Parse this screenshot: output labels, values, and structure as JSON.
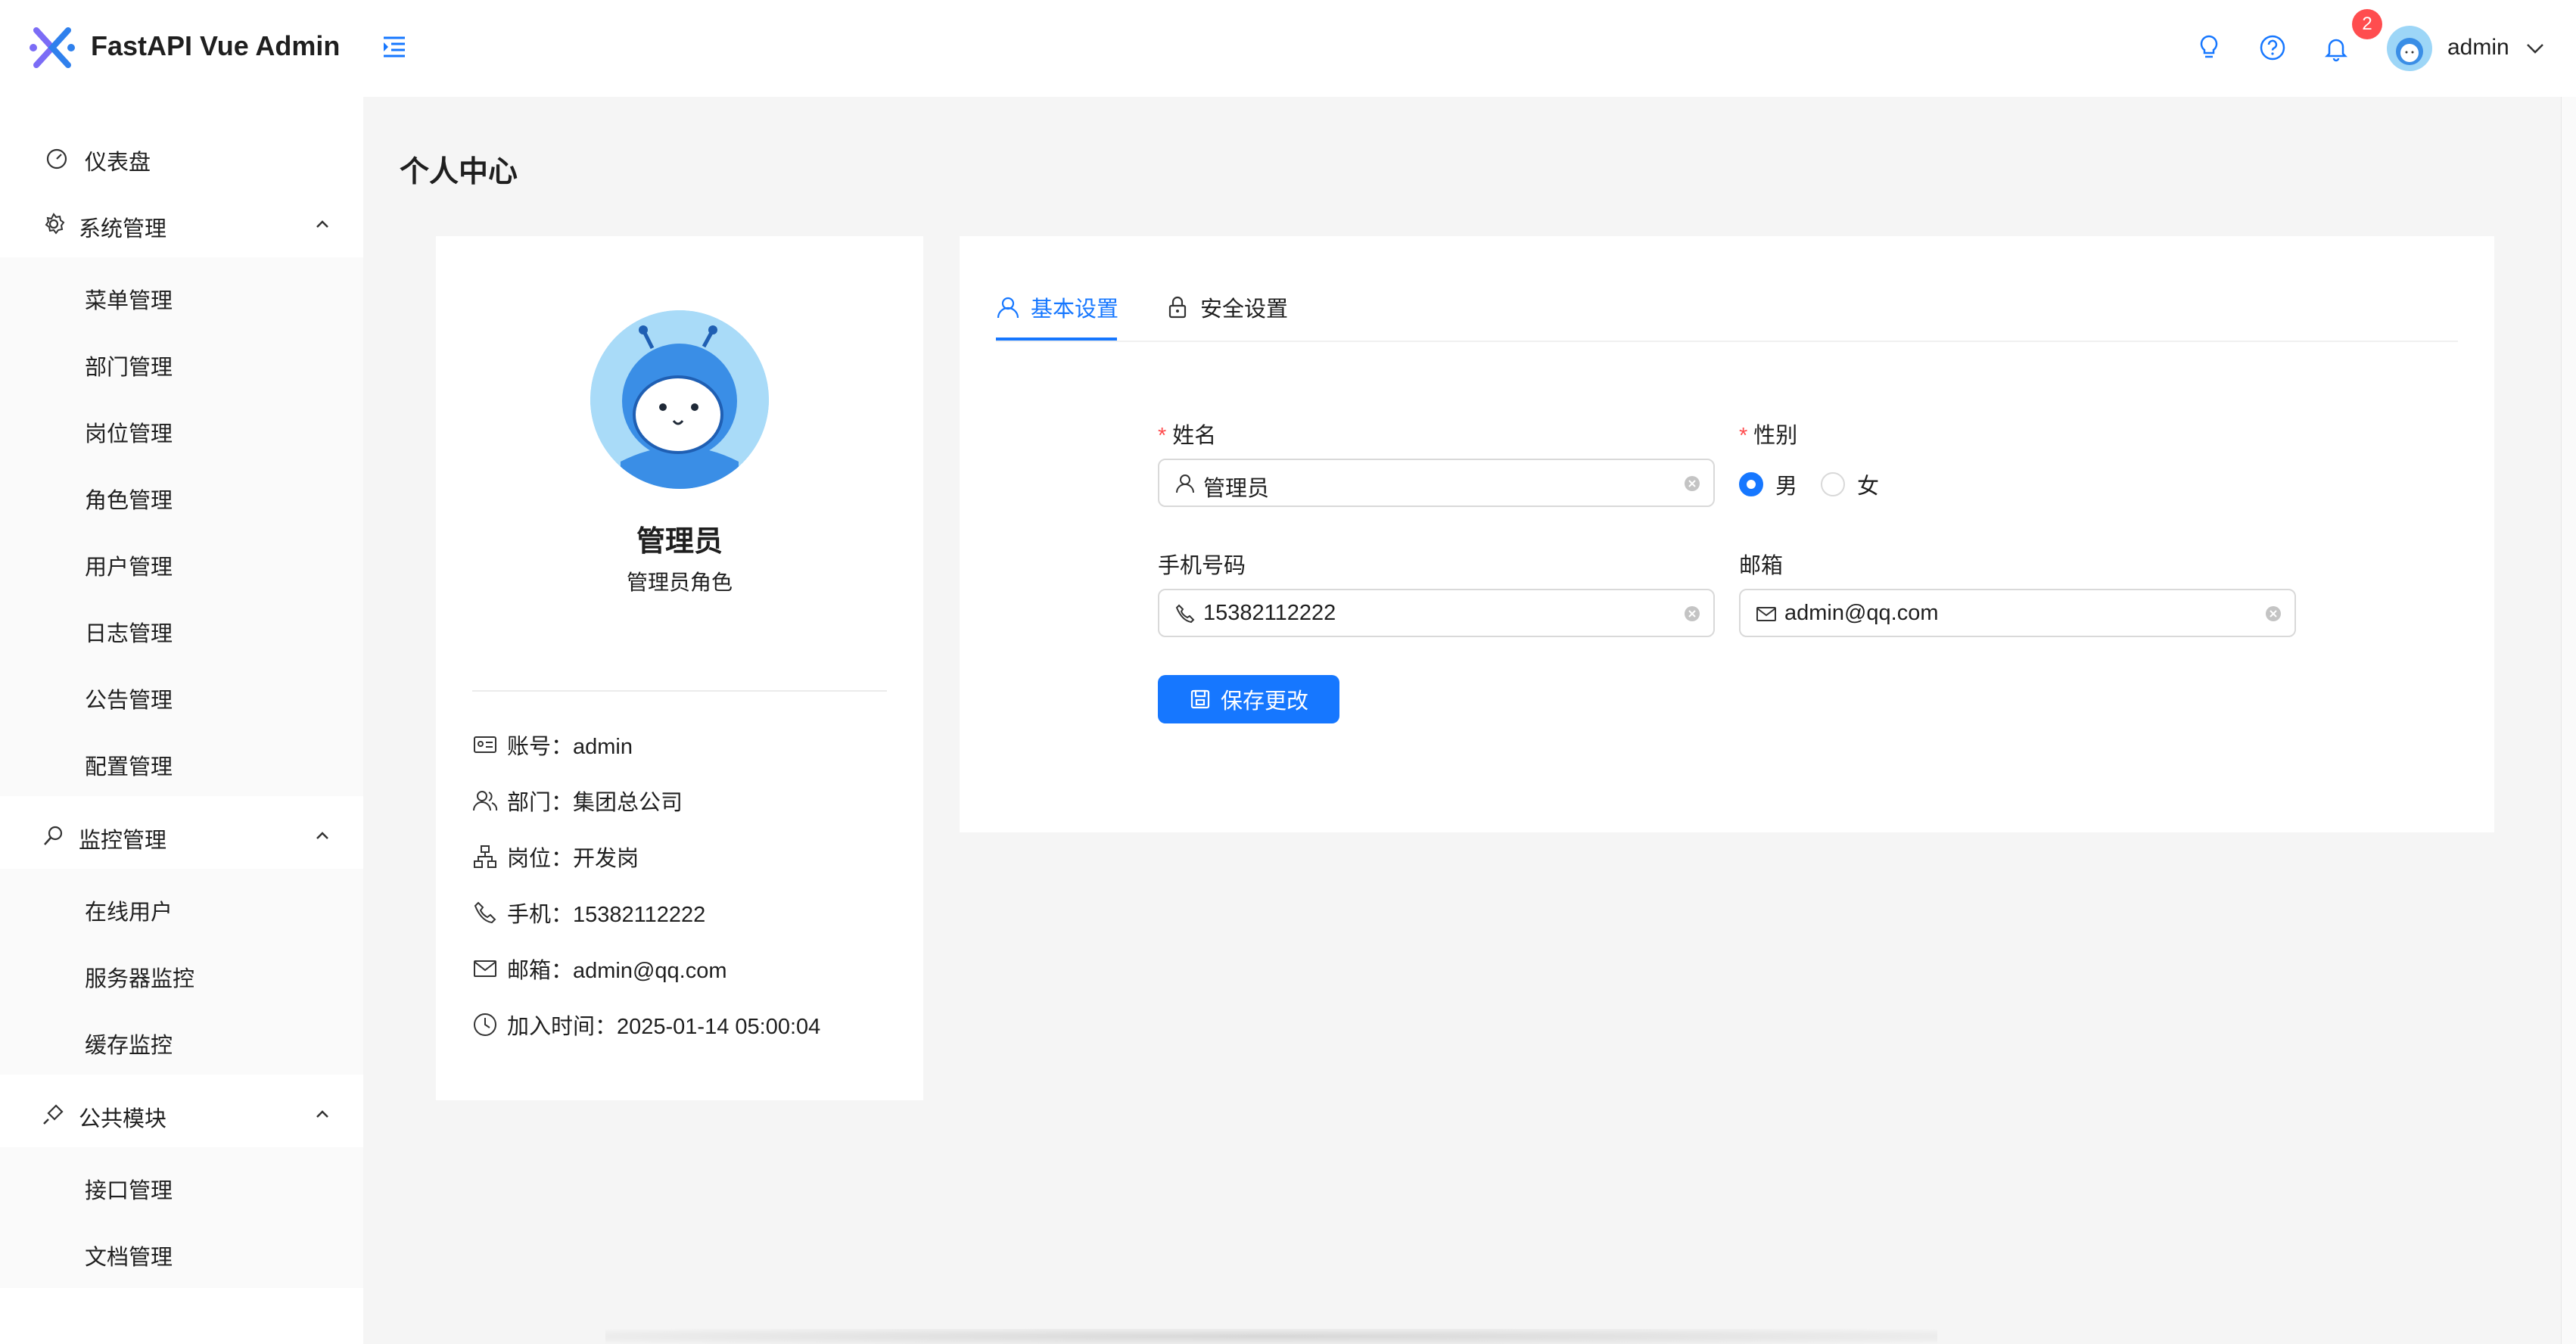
{
  "header": {
    "app_title": "FastAPI Vue Admin",
    "notification_count": "2",
    "user_name": "admin"
  },
  "sidebar": {
    "dashboard": "仪表盘",
    "groups": [
      {
        "label": "系统管理",
        "icon": "gear-icon",
        "items": [
          "菜单管理",
          "部门管理",
          "岗位管理",
          "角色管理",
          "用户管理",
          "日志管理",
          "公告管理",
          "配置管理"
        ]
      },
      {
        "label": "监控管理",
        "icon": "monitor-icon",
        "items": [
          "在线用户",
          "服务器监控",
          "缓存监控"
        ]
      },
      {
        "label": "公共模块",
        "icon": "plug-icon",
        "items": [
          "接口管理",
          "文档管理"
        ]
      }
    ]
  },
  "page": {
    "title": "个人中心"
  },
  "profile": {
    "name": "管理员",
    "role": "管理员角色",
    "info": {
      "account": "账号：admin",
      "department": "部门：集团总公司",
      "position": "岗位：开发岗",
      "phone": "手机：15382112222",
      "email": "邮箱：admin@qq.com",
      "joined": "加入时间：2025-01-14 05:00:04"
    }
  },
  "tabs": {
    "basic": "基本设置",
    "security": "安全设置"
  },
  "form": {
    "name_label": "姓名",
    "name_value": "管理员",
    "gender_label": "性别",
    "gender_options": [
      "男",
      "女"
    ],
    "gender_selected": "男",
    "phone_label": "手机号码",
    "phone_value": "15382112222",
    "email_label": "邮箱",
    "email_value": "admin@qq.com",
    "required_mark": "*",
    "save_label": "保存更改"
  },
  "colors": {
    "primary": "#1677ff",
    "danger": "#ff4d4f",
    "page_bg": "#f5f5f5"
  }
}
